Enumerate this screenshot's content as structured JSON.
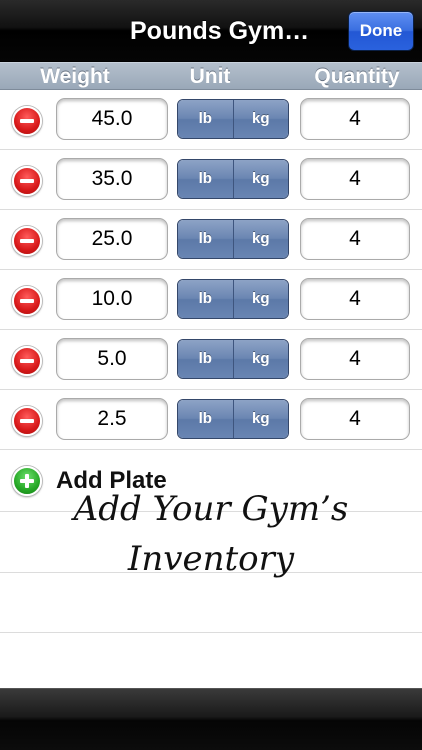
{
  "navbar": {
    "title": "Pounds Gym…",
    "done_label": "Done"
  },
  "columns": {
    "weight": "Weight",
    "unit": "Unit",
    "quantity": "Quantity"
  },
  "plates": [
    {
      "weight": "45.0",
      "unit_lb": "lb",
      "unit_kg": "kg",
      "quantity": "4"
    },
    {
      "weight": "35.0",
      "unit_lb": "lb",
      "unit_kg": "kg",
      "quantity": "4"
    },
    {
      "weight": "25.0",
      "unit_lb": "lb",
      "unit_kg": "kg",
      "quantity": "4"
    },
    {
      "weight": "10.0",
      "unit_lb": "lb",
      "unit_kg": "kg",
      "quantity": "4"
    },
    {
      "weight": "5.0",
      "unit_lb": "lb",
      "unit_kg": "kg",
      "quantity": "4"
    },
    {
      "weight": "2.5",
      "unit_lb": "lb",
      "unit_kg": "kg",
      "quantity": "4"
    }
  ],
  "add_plate_label": "Add Plate",
  "promo": {
    "line1": "Add Your Gym’s",
    "line2": "Inventory"
  },
  "colors": {
    "done_button": "#2f66dc",
    "segment": "#6b86b2",
    "delete": "#d8191a",
    "add": "#26a826"
  },
  "icons": {
    "delete": "minus-circle-icon",
    "add": "plus-circle-icon"
  }
}
